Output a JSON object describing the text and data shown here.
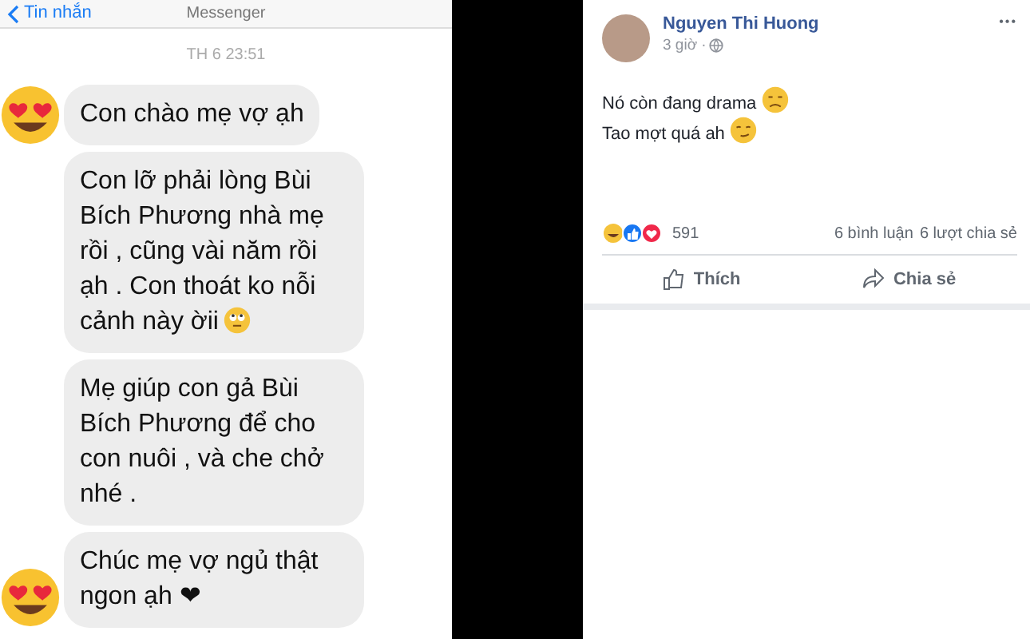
{
  "chat": {
    "back_label": "Tin nhắn",
    "title": "Messenger",
    "timestamp": "TH 6 23:51",
    "messages": [
      {
        "text": "Con chào mẹ vợ ạh",
        "avatar": true,
        "kind": "plain"
      },
      {
        "text": "Con lỡ phải lòng Bùi Bích Phương nhà mẹ rồi , cũng vài năm rồi ạh . Con thoát ko nỗi cảnh này ờii",
        "avatar": false,
        "kind": "face"
      },
      {
        "text": "Mẹ giúp con gả Bùi Bích Phương để cho con nuôi , và che chở nhé .",
        "avatar": false,
        "kind": "plain"
      },
      {
        "text": "Chúc mẹ vợ ngủ thật ngon ạh ❤",
        "avatar": true,
        "kind": "plain"
      }
    ]
  },
  "post": {
    "author": "Nguyen Thi Huong",
    "time": "3 giờ ·",
    "more": "•••",
    "lines": [
      {
        "text": "Nó còn đang drama",
        "kind": "sad"
      },
      {
        "text": "Tao mợt quá ah",
        "kind": "smirk"
      }
    ],
    "reaction_count": "591",
    "comments": "6 bình luận",
    "shares": "6 lượt chia sẻ",
    "actions": [
      {
        "label": "Thích",
        "kind": "like"
      },
      {
        "label": "Chia sẻ",
        "kind": "share"
      }
    ]
  }
}
